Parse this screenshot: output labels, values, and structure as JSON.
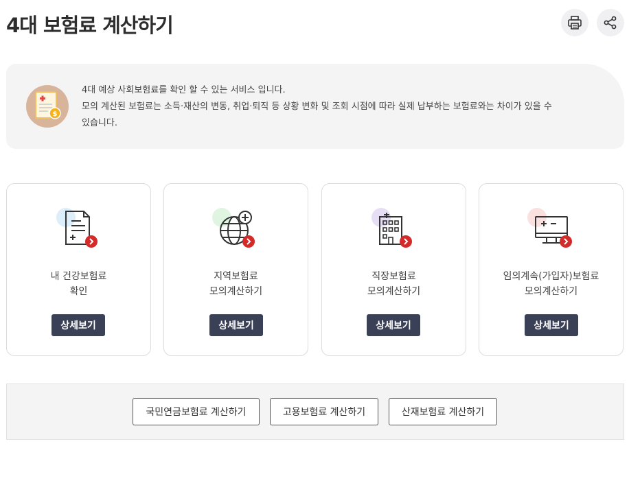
{
  "header": {
    "title": "4대 보험료 계산하기",
    "print_icon": "print-icon",
    "share_icon": "share-icon"
  },
  "info": {
    "icon": "insurance-document-coin-icon",
    "line1": "4대 예상 사회보험료를 확인 할 수 있는 서비스 입니다.",
    "line2": "모의 계산된 보험료는 소득·재산의 변동, 취업·퇴직 등 상황 변화 및 조회 시점에 따라 실제 납부하는 보험료와는 차이가 있을 수",
    "line3": "있습니다."
  },
  "cards": [
    {
      "icon": "document-icon",
      "accent": "#dbeefa",
      "line1": "내 건강보험료",
      "line2": "확인",
      "button": "상세보기"
    },
    {
      "icon": "globe-icon",
      "accent": "#dff5e1",
      "line1": "지역보험료",
      "line2": "모의계산하기",
      "button": "상세보기"
    },
    {
      "icon": "building-icon",
      "accent": "#e6def5",
      "line1": "직장보험료",
      "line2": "모의계산하기",
      "button": "상세보기"
    },
    {
      "icon": "monitor-calculator-icon",
      "accent": "#fbe0e0",
      "line1": "임의계속(가입자)보험료",
      "line2": "모의계산하기",
      "button": "상세보기"
    }
  ],
  "bottom_buttons": [
    "국민연금보험료 계산하기",
    "고용보험료 계산하기",
    "산재보험료 계산하기"
  ],
  "colors": {
    "button_dark": "#3a4056",
    "arrow_badge": "#d32a2a",
    "box_bg": "#f4f4f5"
  }
}
